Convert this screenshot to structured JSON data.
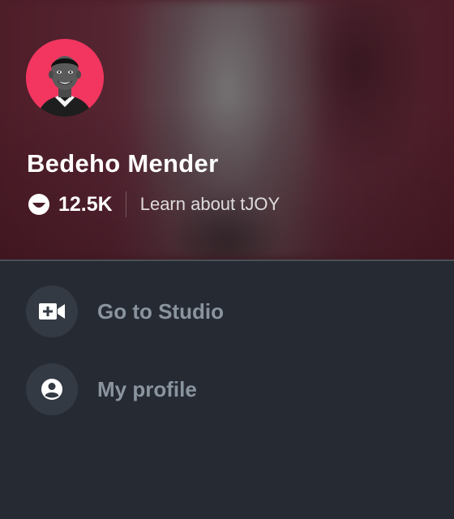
{
  "profile": {
    "name": "Bedeho Mender",
    "joy_count": "12.5K",
    "learn_link": "Learn about tJOY",
    "avatar_bg_color": "#f2365f"
  },
  "menu": {
    "items": [
      {
        "label": "Go to Studio",
        "icon": "video-camera-plus-icon"
      },
      {
        "label": "My profile",
        "icon": "user-circle-icon"
      }
    ]
  },
  "colors": {
    "header_bg": "#4b1e29",
    "panel_bg": "#262a33",
    "menu_icon_bg": "#343a43",
    "menu_text": "#8a949f"
  }
}
